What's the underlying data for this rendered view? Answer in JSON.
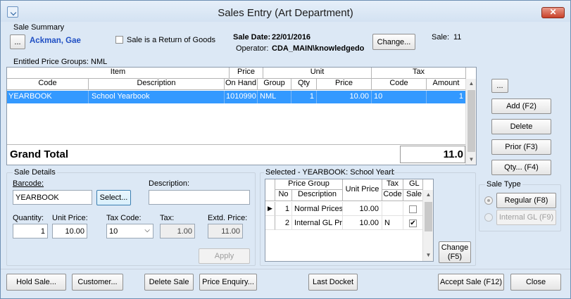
{
  "window": {
    "title": "Sales Entry (Art Department)",
    "close": "✕"
  },
  "summary": {
    "label": "Sale Summary",
    "ellipsis": "...",
    "customer": "Ackman, Gae",
    "return_label": "Sale is a Return of Goods",
    "sale_date_label": "Sale Date:",
    "sale_date": "22/01/2016",
    "operator_label": "Operator:",
    "operator": "CDA_MAIN\\knowledgedo",
    "change": "Change...",
    "sale_label": "Sale:",
    "sale_no": "11",
    "entitled": "Entitled Price Groups: NML"
  },
  "items": {
    "group_headers": {
      "item": "Item",
      "price_group_1": "Price",
      "price_group_2": "Group",
      "unit": "Unit",
      "tax": "Tax"
    },
    "columns": {
      "code": "Code",
      "description": "Description",
      "on_hand": "On Hand",
      "qty": "Qty",
      "price": "Price",
      "tax_code": "Code",
      "amount": "Amount"
    },
    "rows": [
      {
        "code": "YEARBOOK",
        "description": "School Yearbook",
        "on_hand": "1010990",
        "price_group": "NML",
        "qty": "1",
        "price": "10.00",
        "tax_code": "10",
        "amount": "1"
      }
    ],
    "grand_total_label": "Grand Total",
    "grand_total": "11.0"
  },
  "right_buttons": {
    "ellipsis": "...",
    "add": "Add (F2)",
    "delete": "Delete",
    "prior": "Prior (F3)",
    "qty": "Qty... (F4)"
  },
  "sale_type": {
    "label": "Sale Type",
    "regular": "Regular (F8)",
    "internal": "Internal GL (F9)"
  },
  "details": {
    "label": "Sale Details",
    "barcode_label": "Barcode:",
    "barcode": "YEARBOOK",
    "select": "Select...",
    "description_label": "Description:",
    "description": "",
    "quantity_label": "Quantity:",
    "quantity": "1",
    "unit_price_label": "Unit Price:",
    "unit_price": "10.00",
    "tax_code_label": "Tax Code:",
    "tax_code": "10",
    "tax_label": "Tax:",
    "tax": "1.00",
    "extd_price_label": "Extd. Price:",
    "extd_price": "11.00",
    "apply": "Apply"
  },
  "selected": {
    "label": "Selected - YEARBOOK: School Yearbo",
    "headers": {
      "price_group": "Price Group",
      "no": "No",
      "description": "Description",
      "unit_price": "Unit Price",
      "tax_code_1": "Tax",
      "tax_code_2": "Code",
      "gl_1": "GL",
      "gl_2": "Sale"
    },
    "rows": [
      {
        "no": "1",
        "description": "Normal Prices",
        "unit_price": "10.00",
        "tax_code": "",
        "gl": false
      },
      {
        "no": "2",
        "description": "Internal GL Pr",
        "unit_price": "10.00",
        "tax_code": "N",
        "gl": true
      }
    ],
    "change_1": "Change",
    "change_2": "(F5)"
  },
  "footer": {
    "hold": "Hold Sale...",
    "customer": "Customer...",
    "delete_sale": "Delete Sale",
    "price_enquiry": "Price Enquiry...",
    "last_docket": "Last Docket",
    "accept": "Accept Sale (F12)",
    "close": "Close"
  }
}
